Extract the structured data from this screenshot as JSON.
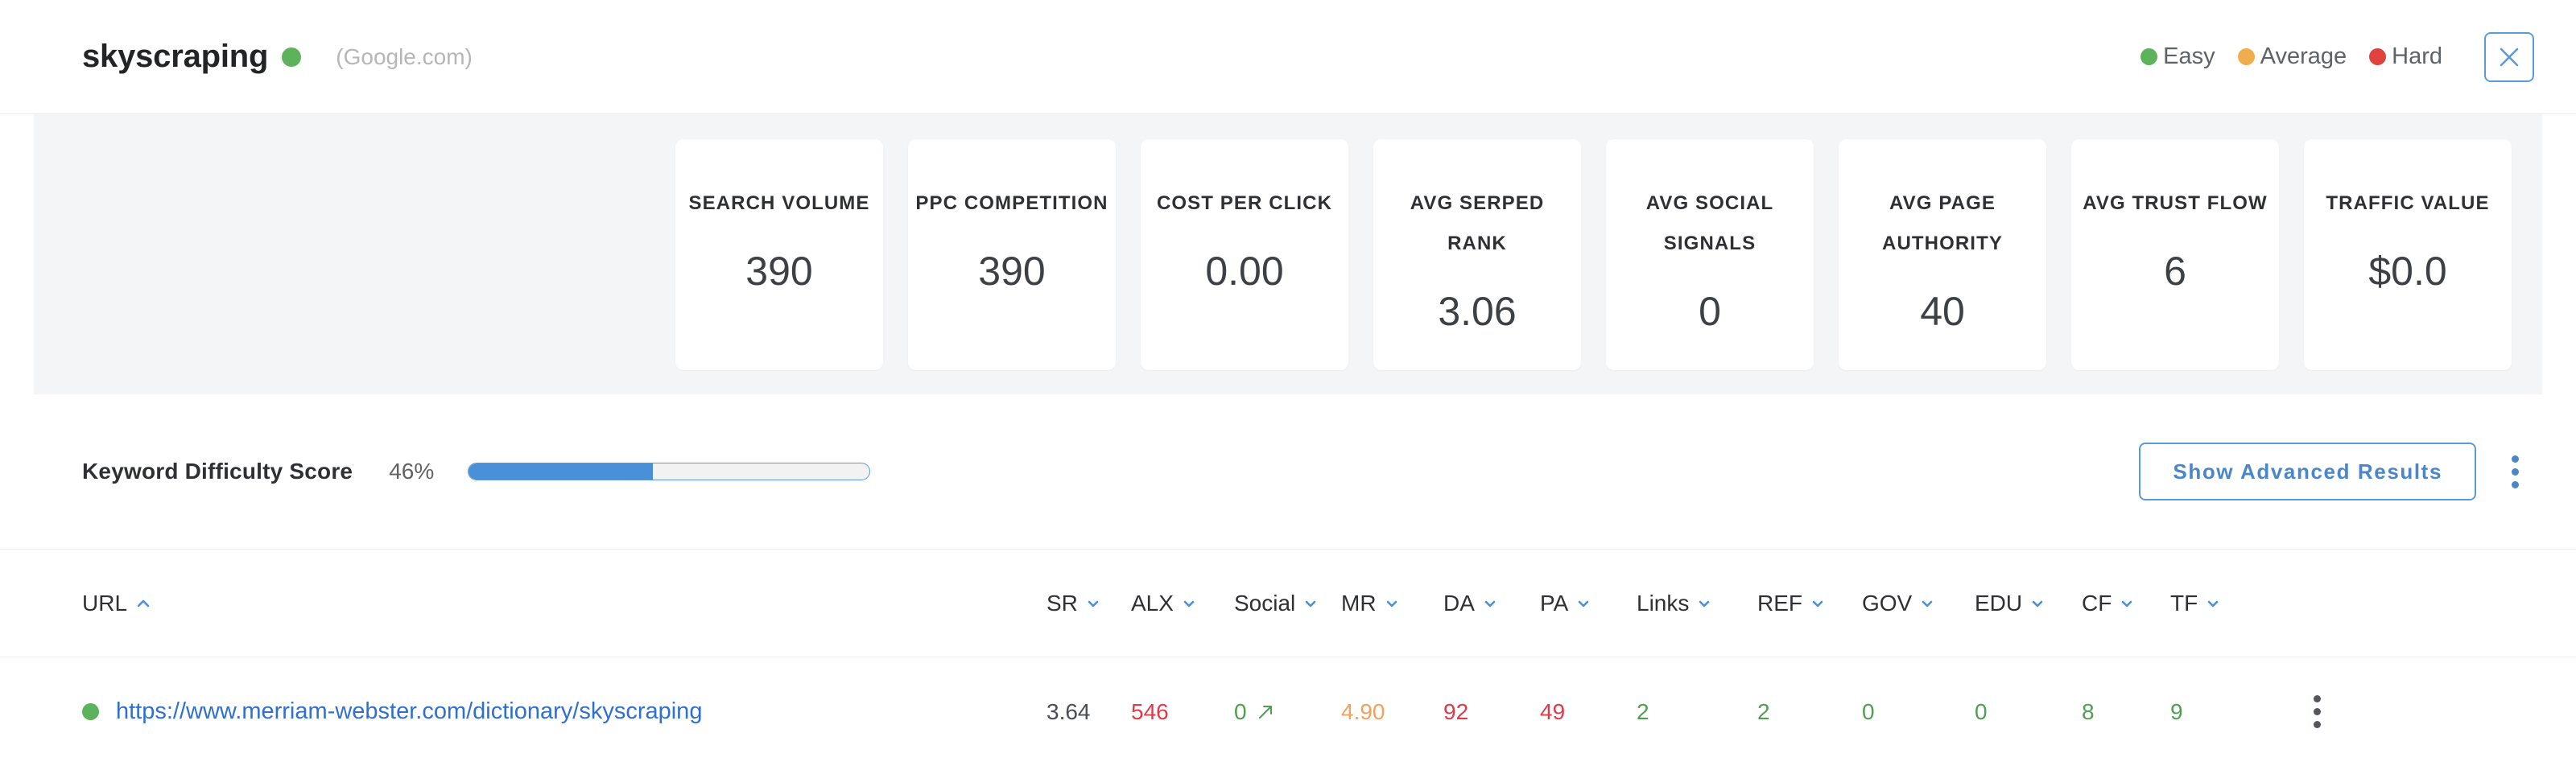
{
  "header": {
    "keyword": "skyscraping",
    "keyword_status_color": "#5cb35c",
    "source": "(Google.com)",
    "legend": [
      {
        "label": "Easy",
        "color": "#5cb35c"
      },
      {
        "label": "Average",
        "color": "#f0ad4e"
      },
      {
        "label": "Hard",
        "color": "#e0423e"
      }
    ],
    "close_icon": "close-icon"
  },
  "metrics": [
    {
      "label": "SEARCH VOLUME",
      "value": "390"
    },
    {
      "label": "PPC COMPETITION",
      "value": "390"
    },
    {
      "label": "COST PER CLICK",
      "value": "0.00"
    },
    {
      "label": "AVG SERPED RANK",
      "value": "3.06"
    },
    {
      "label": "AVG SOCIAL SIGNALS",
      "value": "0"
    },
    {
      "label": "AVG PAGE AUTHORITY",
      "value": "40"
    },
    {
      "label": "AVG TRUST FLOW",
      "value": "6"
    },
    {
      "label": "TRAFFIC VALUE",
      "value": "$0.0"
    }
  ],
  "difficulty": {
    "label": "Keyword Difficulty Score",
    "percent_text": "46%",
    "percent_value": 46,
    "bar_color": "#4a90d9"
  },
  "actions": {
    "advanced_results_label": "Show Advanced Results",
    "more_menu_icon": "kebab-menu-icon"
  },
  "table": {
    "columns": [
      {
        "key": "url",
        "label": "URL",
        "sort": "asc"
      },
      {
        "key": "sr",
        "label": "SR",
        "sort": "none"
      },
      {
        "key": "alx",
        "label": "ALX",
        "sort": "none"
      },
      {
        "key": "social",
        "label": "Social",
        "sort": "none"
      },
      {
        "key": "mr",
        "label": "MR",
        "sort": "none"
      },
      {
        "key": "da",
        "label": "DA",
        "sort": "none"
      },
      {
        "key": "pa",
        "label": "PA",
        "sort": "none"
      },
      {
        "key": "links",
        "label": "Links",
        "sort": "none"
      },
      {
        "key": "ref",
        "label": "REF",
        "sort": "none"
      },
      {
        "key": "gov",
        "label": "GOV",
        "sort": "none"
      },
      {
        "key": "edu",
        "label": "EDU",
        "sort": "none"
      },
      {
        "key": "cf",
        "label": "CF",
        "sort": "none"
      },
      {
        "key": "tf",
        "label": "TF",
        "sort": "none"
      }
    ],
    "rows": [
      {
        "status_color": "#5cb35c",
        "url": "https://www.merriam-webster.com/dictionary/skyscraping",
        "sr": "3.64",
        "alx": "546",
        "social": "0",
        "social_trend_icon": "trend-up-arrow-icon",
        "mr": "4.90",
        "da": "92",
        "pa": "49",
        "links": "2",
        "ref": "2",
        "gov": "0",
        "edu": "0",
        "cf": "8",
        "tf": "9",
        "row_menu_icon": "kebab-menu-icon"
      }
    ],
    "value_colors": {
      "sr": "#4a4d52",
      "alx": "#dd3b4a",
      "social": "#4f9e52",
      "mr": "#f0a15e",
      "da": "#dd3b4a",
      "pa": "#dd3b4a",
      "links": "#4f9e52",
      "ref": "#4f9e52",
      "gov": "#4f9e52",
      "edu": "#4f9e52",
      "cf": "#4f9e52",
      "tf": "#4f9e52"
    }
  }
}
